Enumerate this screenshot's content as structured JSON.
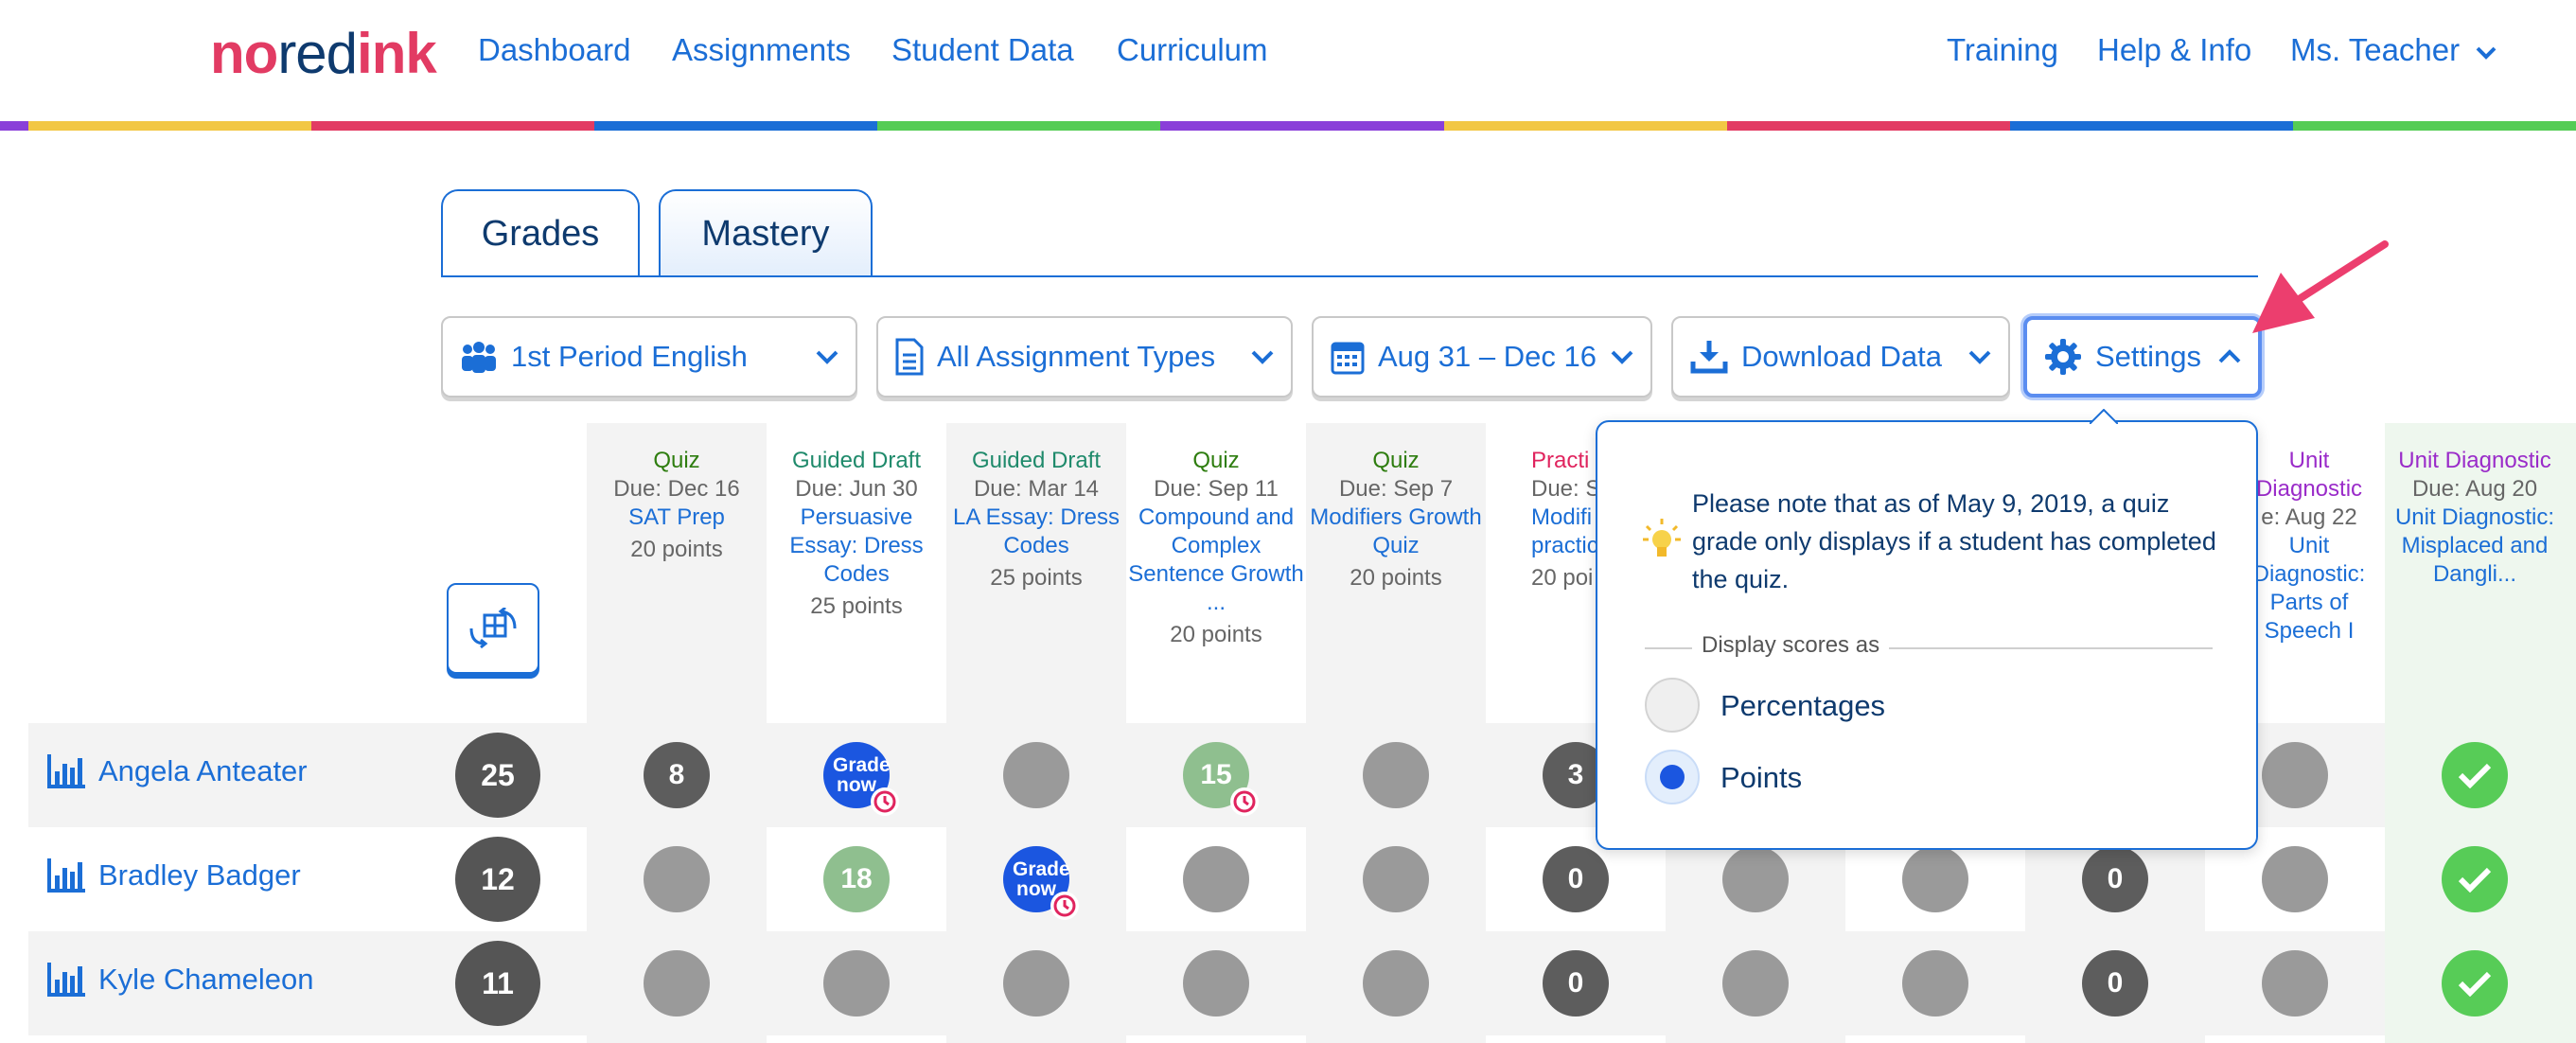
{
  "header": {
    "logo": {
      "part1": "no",
      "part2": "red",
      "part3": "ink"
    },
    "nav_left": [
      "Dashboard",
      "Assignments",
      "Student Data",
      "Curriculum"
    ],
    "nav_right": [
      "Training",
      "Help & Info"
    ],
    "user_menu": "Ms. Teacher",
    "stripe_colors": [
      "#8a3fd9",
      "#f2c744",
      "#e23b63",
      "#1b6ed6",
      "#55cc55",
      "#8a3fd9",
      "#f2c744",
      "#e23b63",
      "#1b6ed6",
      "#55cc55"
    ]
  },
  "tabs": [
    "Grades",
    "Mastery"
  ],
  "filters": {
    "class": "1st Period English",
    "assignment_types": "All Assignment Types",
    "date_range": "Aug 31 – Dec 16",
    "download": "Download Data",
    "settings": "Settings"
  },
  "columns": [
    {
      "type": "Quiz",
      "type_color": "green",
      "due": "Due: Dec 16",
      "title": "SAT Prep",
      "points": "20 points"
    },
    {
      "type": "Guided Draft",
      "type_color": "teal",
      "due": "Due: Jun 30",
      "title": "Persuasive Essay: Dress Codes",
      "points": "25 points"
    },
    {
      "type": "Guided Draft",
      "type_color": "teal",
      "due": "Due: Mar 14",
      "title": "LA Essay: Dress Codes",
      "points": "25 points"
    },
    {
      "type": "Quiz",
      "type_color": "green",
      "due": "Due: Sep 11",
      "title": "Compound and Complex Sentence Growth ...",
      "points": "20 points"
    },
    {
      "type": "Quiz",
      "type_color": "green",
      "due": "Due: Sep 7",
      "title": "Modifiers Growth Quiz",
      "points": "20 points"
    },
    {
      "type": "Practi",
      "type_color": "pink",
      "due": "Due: Se",
      "title": "Modifi practic",
      "points": "20 poi"
    },
    {
      "type": "Unit Diagnostic",
      "type_color": "purple",
      "due": "e: Aug 22",
      "title": "Unit Diagnostic: Parts of Speech I",
      "points": ""
    },
    {
      "type": "Unit Diagnostic",
      "type_color": "purple",
      "due": "Due: Aug 20",
      "title": "Unit Diagnostic: Misplaced and Dangli...",
      "points": ""
    }
  ],
  "students": [
    {
      "name": "Angela Anteater",
      "total": "25"
    },
    {
      "name": "Bradley Badger",
      "total": "12"
    },
    {
      "name": "Kyle Chameleon",
      "total": "11"
    }
  ],
  "cells": {
    "grade_now": "Grade now",
    "r0": {
      "c1": "8",
      "c4": "15",
      "c6": "3"
    },
    "r1": {
      "c2": "18",
      "c6": "0",
      "c9": "0"
    },
    "r2": {
      "c6": "0",
      "c9": "0"
    }
  },
  "settings_popup": {
    "note": "Please note that as of May 9, 2019, a quiz grade only displays if a student has completed the quiz.",
    "display_label": "Display scores as",
    "options": [
      "Percentages",
      "Points"
    ],
    "selected": "Points"
  },
  "colors": {
    "brand_blue": "#1b6ed6",
    "logo_pink": "#e23b63",
    "logo_dark": "#0e3a6e"
  }
}
